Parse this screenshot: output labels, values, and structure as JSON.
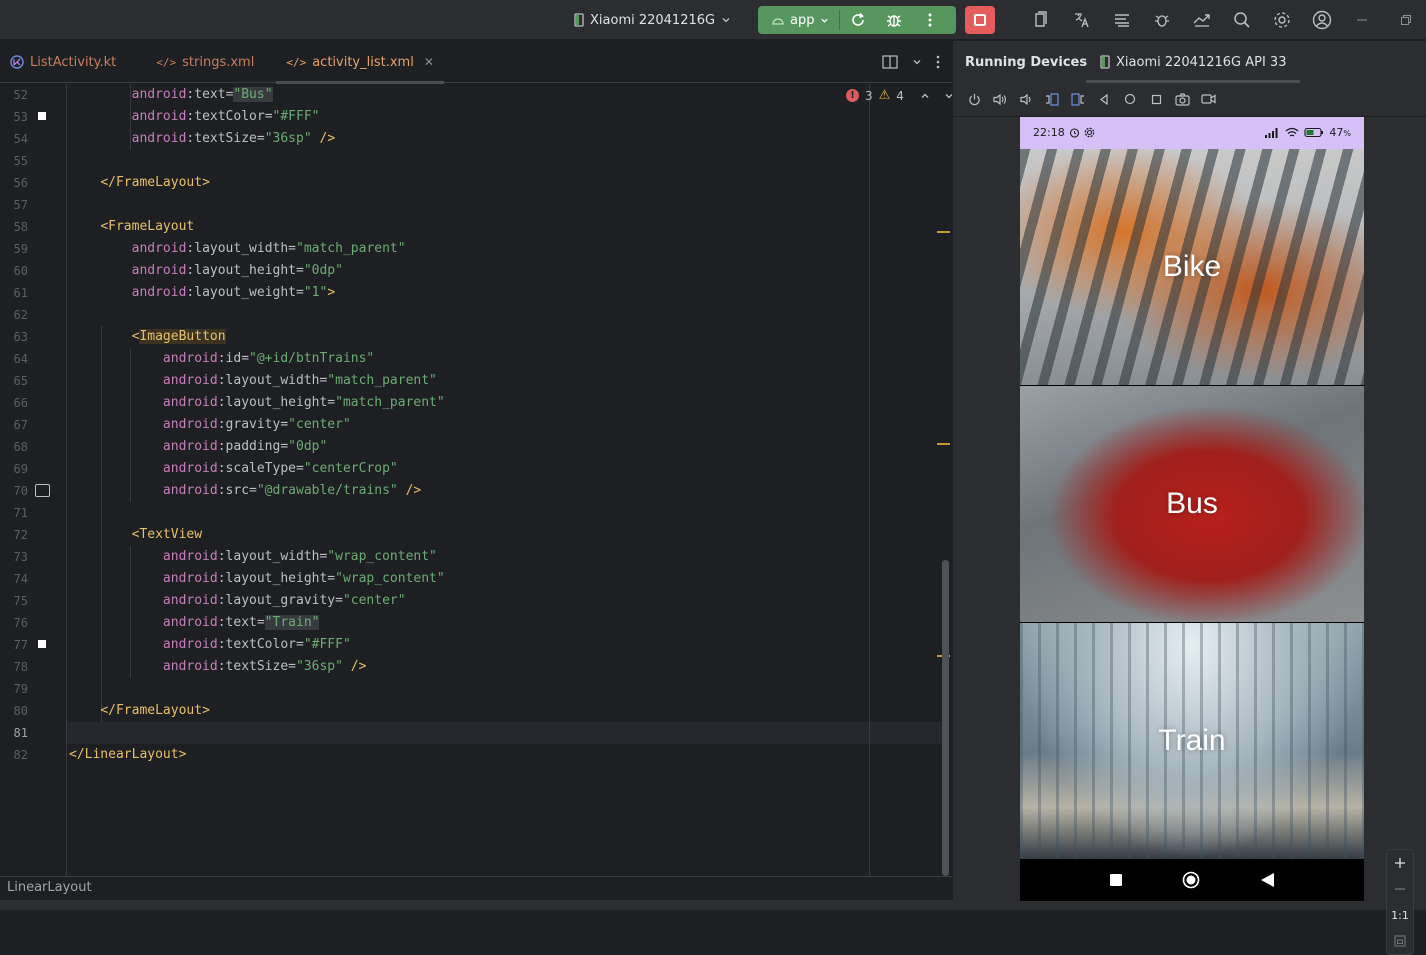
{
  "toolbar": {
    "device": "Xiaomi 22041216G",
    "run_config": "app"
  },
  "tabs": [
    {
      "label": "ListActivity.kt",
      "icon": "kotlin-icon"
    },
    {
      "label": "strings.xml",
      "icon": "xml-icon"
    },
    {
      "label": "activity_list.xml",
      "icon": "xml-icon",
      "active": true
    }
  ],
  "inspections": {
    "errors": "3",
    "warnings": "4"
  },
  "editor": {
    "current_line": "81",
    "lines": [
      {
        "n": "52",
        "t": "        android:text=\"Bus\""
      },
      {
        "n": "53",
        "t": "        android:textColor=\"#FFF\""
      },
      {
        "n": "54",
        "t": "        android:textSize=\"36sp\" />"
      },
      {
        "n": "55",
        "t": ""
      },
      {
        "n": "56",
        "t": "    </FrameLayout>"
      },
      {
        "n": "57",
        "t": ""
      },
      {
        "n": "58",
        "t": "    <FrameLayout"
      },
      {
        "n": "59",
        "t": "        android:layout_width=\"match_parent\""
      },
      {
        "n": "60",
        "t": "        android:layout_height=\"0dp\""
      },
      {
        "n": "61",
        "t": "        android:layout_weight=\"1\">"
      },
      {
        "n": "62",
        "t": ""
      },
      {
        "n": "63",
        "t": "        <ImageButton"
      },
      {
        "n": "64",
        "t": "            android:id=\"@+id/btnTrains\""
      },
      {
        "n": "65",
        "t": "            android:layout_width=\"match_parent\""
      },
      {
        "n": "66",
        "t": "            android:layout_height=\"match_parent\""
      },
      {
        "n": "67",
        "t": "            android:gravity=\"center\""
      },
      {
        "n": "68",
        "t": "            android:padding=\"0dp\""
      },
      {
        "n": "69",
        "t": "            android:scaleType=\"centerCrop\""
      },
      {
        "n": "70",
        "t": "            android:src=\"@drawable/trains\" />"
      },
      {
        "n": "71",
        "t": ""
      },
      {
        "n": "72",
        "t": "        <TextView"
      },
      {
        "n": "73",
        "t": "            android:layout_width=\"wrap_content\""
      },
      {
        "n": "74",
        "t": "            android:layout_height=\"wrap_content\""
      },
      {
        "n": "75",
        "t": "            android:layout_gravity=\"center\""
      },
      {
        "n": "76",
        "t": "            android:text=\"Train\""
      },
      {
        "n": "77",
        "t": "            android:textColor=\"#FFF\""
      },
      {
        "n": "78",
        "t": "            android:textSize=\"36sp\" />"
      },
      {
        "n": "79",
        "t": ""
      },
      {
        "n": "80",
        "t": "    </FrameLayout>"
      },
      {
        "n": "81",
        "t": ""
      },
      {
        "n": "82",
        "t": "</LinearLayout>"
      }
    ]
  },
  "status_bar": {
    "breadcrumb": "LinearLayout"
  },
  "running_devices": {
    "title": "Running Devices",
    "device_tab": "Xiaomi 22041216G API 33"
  },
  "phone": {
    "time": "22:18",
    "battery": "47",
    "tiles": [
      {
        "label": "Bike"
      },
      {
        "label": "Bus"
      },
      {
        "label": "Train"
      }
    ]
  },
  "zoom": {
    "actual_size": "1:1"
  },
  "colors": {
    "accent_run": "#57965c",
    "stop": "#e55c5c",
    "status_bar_bg": "#d6c0f7"
  }
}
